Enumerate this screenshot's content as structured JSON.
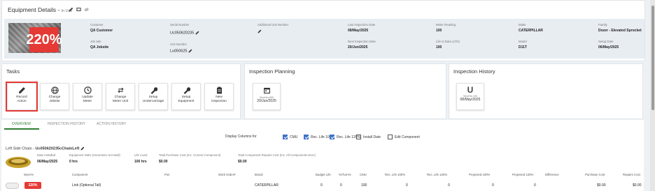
{
  "header": {
    "title": "Equipment Details -",
    "status": "In Use"
  },
  "equipment": {
    "percent": "220%",
    "fields": [
      {
        "label": "Customer",
        "value": "QA Customer"
      },
      {
        "label": "Job Site",
        "value": "QA Jobsite"
      },
      {
        "label": "Serial Number",
        "value": "Uc050620235"
      },
      {
        "label": "Unit Number",
        "value": "Lu050625"
      },
      {
        "label": "Additional Unit Number",
        "value": ""
      },
      {
        "label": "Last Inspection Date",
        "value": "08/May/2025"
      },
      {
        "label": "Next Inspection Date",
        "value": "20/Jun/2025"
      },
      {
        "label": "Meter Reading",
        "value": "100"
      },
      {
        "label": "Life to Date (LTD)",
        "value": "100"
      },
      {
        "label": "Make",
        "value": "CATERPILLAR"
      },
      {
        "label": "Model",
        "value": "D11T"
      },
      {
        "label": "Family",
        "value": "Dozer - Elevated Sprocket"
      },
      {
        "label": "Setup Date",
        "value": "06/May/2025"
      }
    ]
  },
  "tasks": {
    "title": "Tasks",
    "items": [
      {
        "label1": "Record",
        "label2": "Action"
      },
      {
        "label1": "Change",
        "label2": "Jobsite"
      },
      {
        "label1": "Update",
        "label2": "Meter"
      },
      {
        "label1": "Change",
        "label2": "Meter Unit"
      },
      {
        "label1": "Setup",
        "label2": "Undercarriage"
      },
      {
        "label1": "Setup",
        "label2": "Equipment"
      },
      {
        "label1": "New",
        "label2": "Inspection"
      }
    ]
  },
  "inspection_planning": {
    "title": "Inspection Planning",
    "card_line": "SmuHrs 800",
    "card_date": "20/Jun/2025"
  },
  "inspection_history": {
    "title": "Inspection History",
    "card_letter": "U",
    "card_line": "SmuHrs 100",
    "card_date": "08/May/2025"
  },
  "tabs": [
    "OVERVIEW",
    "INSPECTION HISTORY",
    "ACTION HISTORY"
  ],
  "display_columns": {
    "label": "Display Columns for",
    "options": [
      {
        "label": "CMU",
        "checked": true
      },
      {
        "label": "Rec. Life 100%",
        "checked": true
      },
      {
        "label": "Rec. Life 120%",
        "checked": true
      },
      {
        "label": "Install Date",
        "checked": false
      },
      {
        "label": "Edit Component",
        "checked": false
      }
    ]
  },
  "component": {
    "title_prefix": "Left Side Chain -",
    "title_name": "Uc050620235cChainLeft",
    "fields": [
      {
        "label": "Date Installed",
        "value": "06/May/2025"
      },
      {
        "label": "Equipment SMU (Hourmeter at Install)",
        "value": "0 hrs"
      },
      {
        "label": "Life Lived",
        "value": "100 hrs"
      },
      {
        "label": "Total Purchase Cost (Inc. Current Component)",
        "value": "$0.00"
      },
      {
        "label": "Total Component Repairs Cost (Inc. All Components Ever)",
        "value": "$0.00"
      }
    ]
  },
  "table": {
    "headers": [
      "Worn%",
      "Component",
      "Pos",
      "Work Order#",
      "Brand",
      "Budget Life",
      "%/Turn%",
      "CMU",
      "Rec. Life 100%",
      "Rec. Life 120%",
      "Projected 100%",
      "Projected 120%",
      "Difference",
      "Purchase Cost",
      "Repairs Cost"
    ],
    "row": {
      "worn": "220%",
      "component": "Link (Optional Tall)",
      "pos": "",
      "work_order": "",
      "brand": "CATERPILLAR",
      "budget_life": "0",
      "turn": "0",
      "cmu": "100",
      "rec100": "0",
      "rec120": "0",
      "proj100": "0",
      "proj120": "0",
      "difference": "",
      "purchase": "$0.00",
      "repairs": "$0.00"
    }
  },
  "colors": {
    "accent_red": "#e53935",
    "active_tab": "#2e7d32",
    "checkbox": "#3d72c9"
  }
}
